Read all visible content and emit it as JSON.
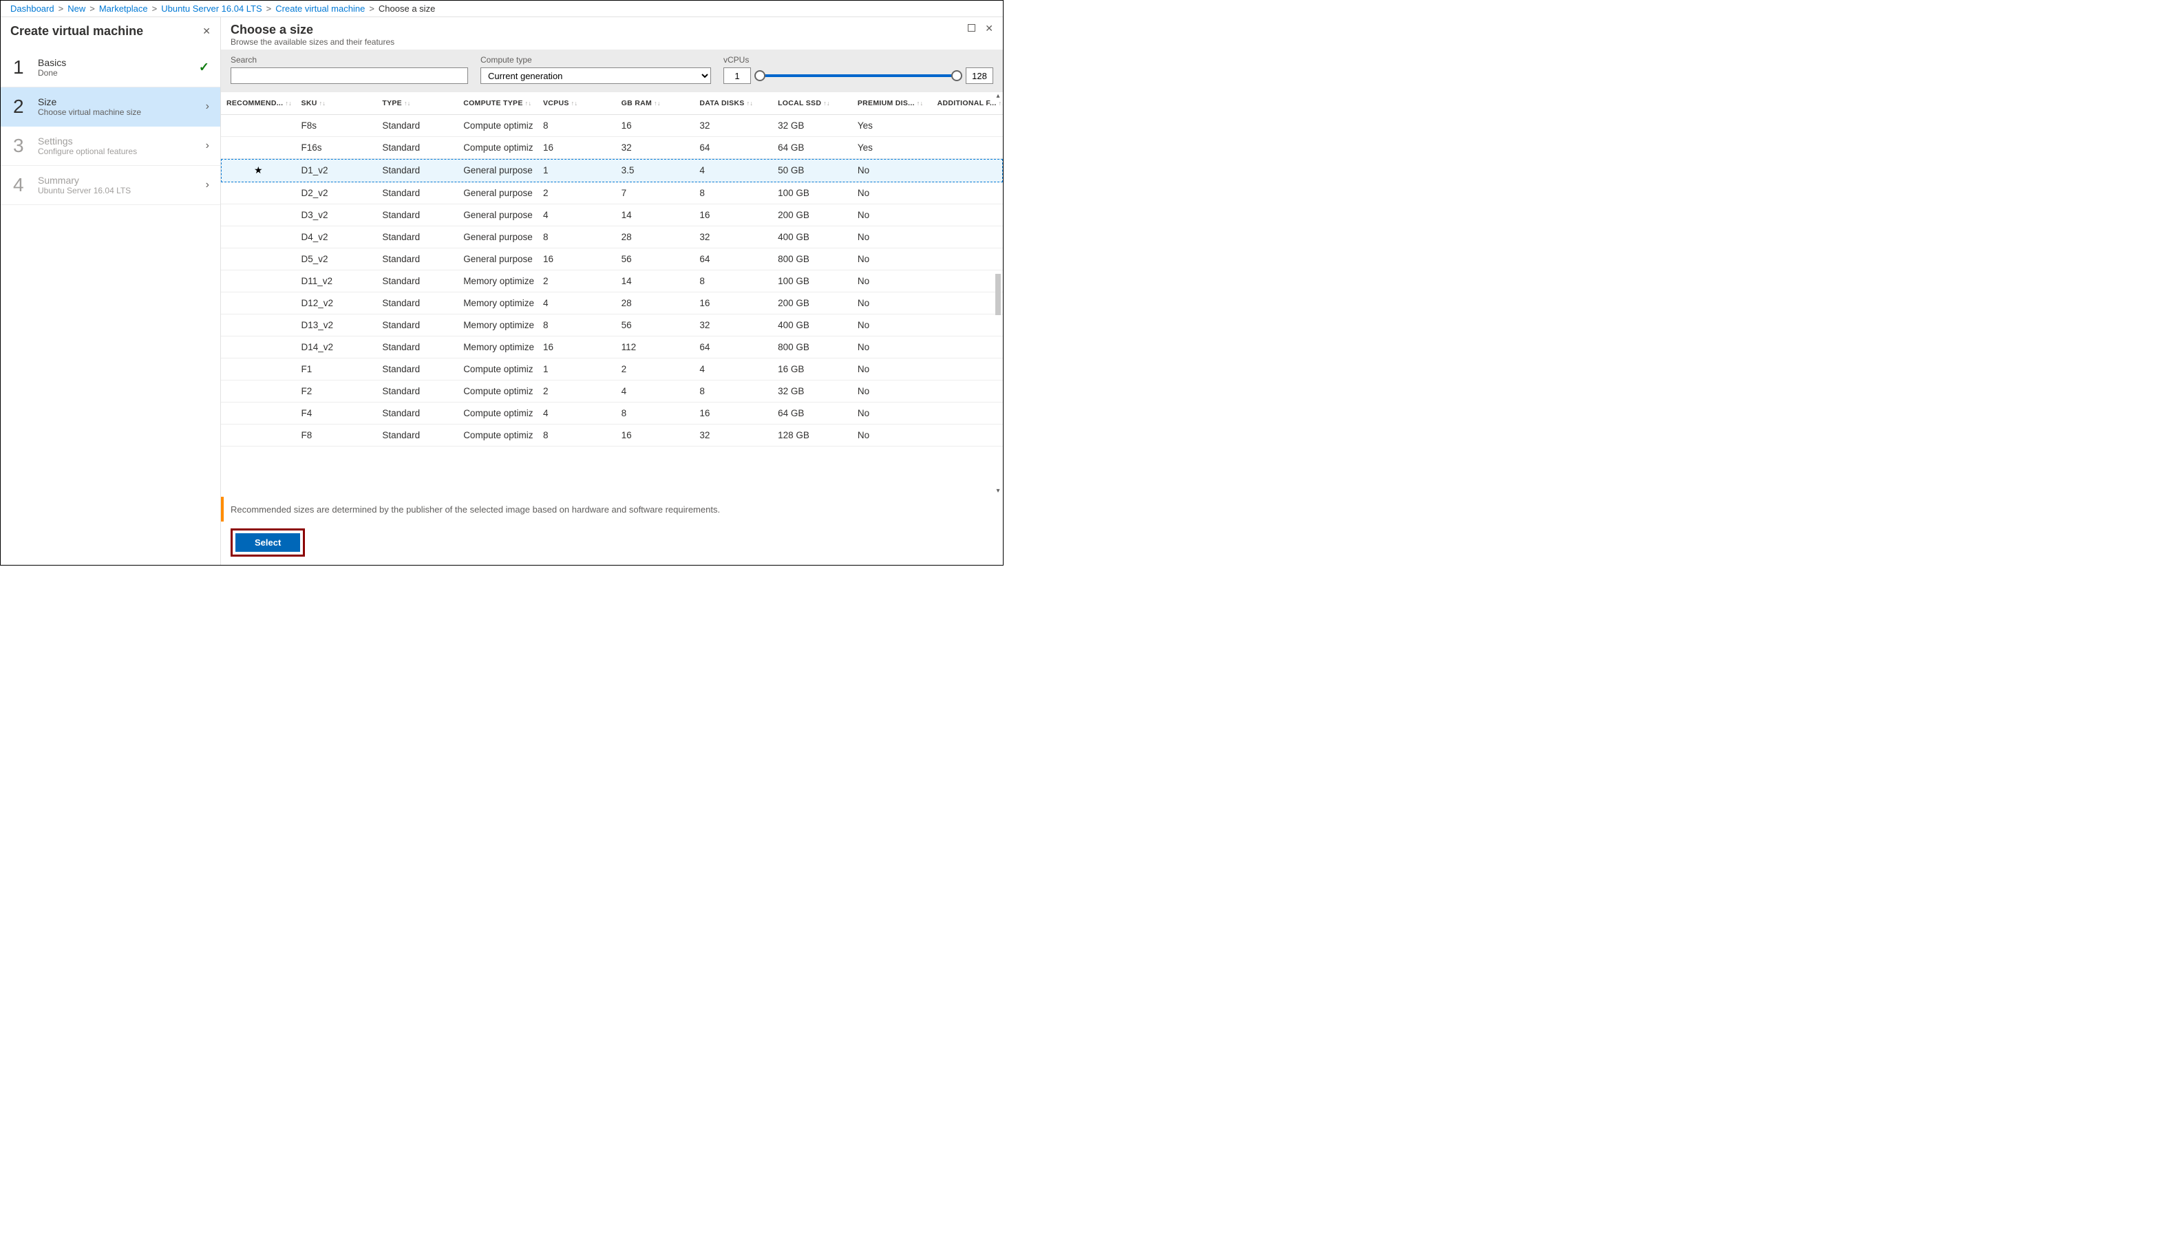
{
  "breadcrumb": {
    "items": [
      "Dashboard",
      "New",
      "Marketplace",
      "Ubuntu Server 16.04 LTS",
      "Create virtual machine"
    ],
    "current": "Choose a size"
  },
  "leftPanel": {
    "title": "Create virtual machine",
    "steps": [
      {
        "num": "1",
        "title": "Basics",
        "sub": "Done",
        "status": "done"
      },
      {
        "num": "2",
        "title": "Size",
        "sub": "Choose virtual machine size",
        "status": "active"
      },
      {
        "num": "3",
        "title": "Settings",
        "sub": "Configure optional features",
        "status": "disabled"
      },
      {
        "num": "4",
        "title": "Summary",
        "sub": "Ubuntu Server 16.04 LTS",
        "status": "disabled"
      }
    ]
  },
  "rightPanel": {
    "title": "Choose a size",
    "subtitle": "Browse the available sizes and their features"
  },
  "filters": {
    "searchLabel": "Search",
    "searchValue": "",
    "computeLabel": "Compute type",
    "computeValue": "Current generation",
    "vcpuLabel": "vCPUs",
    "vcpuMin": "1",
    "vcpuMax": "128"
  },
  "columns": [
    "RECOMMEND...",
    "SKU",
    "TYPE",
    "COMPUTE TYPE",
    "VCPUS",
    "GB RAM",
    "DATA DISKS",
    "LOCAL SSD",
    "PREMIUM DIS...",
    "ADDITIONAL F..."
  ],
  "rows": [
    {
      "rec": "",
      "sku": "F8s",
      "type": "Standard",
      "ctype": "Compute optimiz",
      "vcpus": "8",
      "ram": "16",
      "disks": "32",
      "ssd": "32 GB",
      "prem": "Yes",
      "sel": false
    },
    {
      "rec": "",
      "sku": "F16s",
      "type": "Standard",
      "ctype": "Compute optimiz",
      "vcpus": "16",
      "ram": "32",
      "disks": "64",
      "ssd": "64 GB",
      "prem": "Yes",
      "sel": false
    },
    {
      "rec": "★",
      "sku": "D1_v2",
      "type": "Standard",
      "ctype": "General purpose",
      "vcpus": "1",
      "ram": "3.5",
      "disks": "4",
      "ssd": "50 GB",
      "prem": "No",
      "sel": true
    },
    {
      "rec": "",
      "sku": "D2_v2",
      "type": "Standard",
      "ctype": "General purpose",
      "vcpus": "2",
      "ram": "7",
      "disks": "8",
      "ssd": "100 GB",
      "prem": "No",
      "sel": false
    },
    {
      "rec": "",
      "sku": "D3_v2",
      "type": "Standard",
      "ctype": "General purpose",
      "vcpus": "4",
      "ram": "14",
      "disks": "16",
      "ssd": "200 GB",
      "prem": "No",
      "sel": false
    },
    {
      "rec": "",
      "sku": "D4_v2",
      "type": "Standard",
      "ctype": "General purpose",
      "vcpus": "8",
      "ram": "28",
      "disks": "32",
      "ssd": "400 GB",
      "prem": "No",
      "sel": false
    },
    {
      "rec": "",
      "sku": "D5_v2",
      "type": "Standard",
      "ctype": "General purpose",
      "vcpus": "16",
      "ram": "56",
      "disks": "64",
      "ssd": "800 GB",
      "prem": "No",
      "sel": false
    },
    {
      "rec": "",
      "sku": "D11_v2",
      "type": "Standard",
      "ctype": "Memory optimize",
      "vcpus": "2",
      "ram": "14",
      "disks": "8",
      "ssd": "100 GB",
      "prem": "No",
      "sel": false
    },
    {
      "rec": "",
      "sku": "D12_v2",
      "type": "Standard",
      "ctype": "Memory optimize",
      "vcpus": "4",
      "ram": "28",
      "disks": "16",
      "ssd": "200 GB",
      "prem": "No",
      "sel": false
    },
    {
      "rec": "",
      "sku": "D13_v2",
      "type": "Standard",
      "ctype": "Memory optimize",
      "vcpus": "8",
      "ram": "56",
      "disks": "32",
      "ssd": "400 GB",
      "prem": "No",
      "sel": false
    },
    {
      "rec": "",
      "sku": "D14_v2",
      "type": "Standard",
      "ctype": "Memory optimize",
      "vcpus": "16",
      "ram": "112",
      "disks": "64",
      "ssd": "800 GB",
      "prem": "No",
      "sel": false
    },
    {
      "rec": "",
      "sku": "F1",
      "type": "Standard",
      "ctype": "Compute optimiz",
      "vcpus": "1",
      "ram": "2",
      "disks": "4",
      "ssd": "16 GB",
      "prem": "No",
      "sel": false
    },
    {
      "rec": "",
      "sku": "F2",
      "type": "Standard",
      "ctype": "Compute optimiz",
      "vcpus": "2",
      "ram": "4",
      "disks": "8",
      "ssd": "32 GB",
      "prem": "No",
      "sel": false
    },
    {
      "rec": "",
      "sku": "F4",
      "type": "Standard",
      "ctype": "Compute optimiz",
      "vcpus": "4",
      "ram": "8",
      "disks": "16",
      "ssd": "64 GB",
      "prem": "No",
      "sel": false
    },
    {
      "rec": "",
      "sku": "F8",
      "type": "Standard",
      "ctype": "Compute optimiz",
      "vcpus": "8",
      "ram": "16",
      "disks": "32",
      "ssd": "128 GB",
      "prem": "No",
      "sel": false
    }
  ],
  "note": "Recommended sizes are determined by the publisher of the selected image based on hardware and software requirements.",
  "footer": {
    "selectLabel": "Select"
  }
}
